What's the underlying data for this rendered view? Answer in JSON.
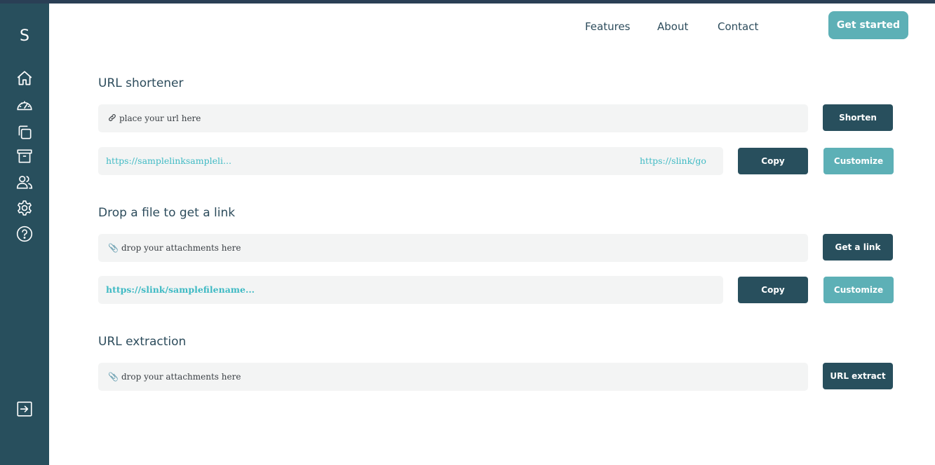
{
  "sidebar": {
    "logo": "S",
    "icons": [
      "home-icon",
      "dashboard-icon",
      "copy-icon",
      "archive-icon",
      "users-icon",
      "settings-icon",
      "help-icon",
      "logout-icon"
    ]
  },
  "nav": {
    "features": "Features",
    "about": "About",
    "contact": "Contact",
    "get_started": "Get started"
  },
  "url_shortener": {
    "title": "URL shortener",
    "input_placeholder": "place your url here",
    "input_icon": "link-icon",
    "shorten_button": "Shorten",
    "long_url": "https://samplelinksampleli...",
    "short_url": "https://slink/go",
    "copy_button": "Copy",
    "customize_button": "Customize"
  },
  "file_drop": {
    "title": "Drop a file to get a link",
    "input_placeholder": "drop your attachments here",
    "input_icon": "paperclip-icon",
    "get_link_button": "Get a link",
    "file_url": "https://slink/samplefilename...",
    "copy_button": "Copy",
    "customize_button": "Customize"
  },
  "url_extraction": {
    "title": "URL extraction",
    "input_placeholder": "drop your attachments here",
    "input_icon": "paperclip-icon",
    "extract_button": "URL extract"
  },
  "colors": {
    "sidebar": "#284f5d",
    "accent": "#5db0b6",
    "dark_button": "#284f5d",
    "link": "#3fbac4",
    "field_bg": "#f3f4f4"
  }
}
